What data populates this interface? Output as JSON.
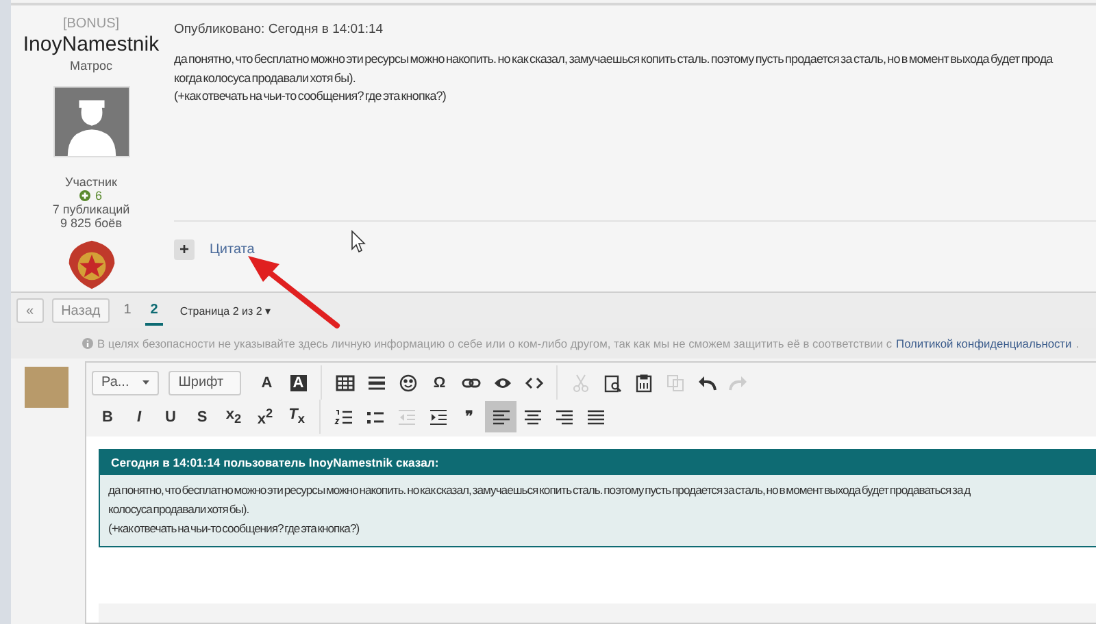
{
  "post": {
    "author": {
      "group": "[BONUS]",
      "name": "InoyNamestnik",
      "rank": "Матрос",
      "role": "Участник",
      "reputation": "6",
      "posts": "7 публикаций",
      "battles": "9 825 боёв"
    },
    "published": "Опубликовано: Сегодня в 14:01:14",
    "lines": [
      "да понятно, что бесплатно можно эти ресурсы можно накопить. но как сказал, замучаешься копить сталь. поэтому пусть продается за сталь, но в момент выхода будет прода",
      "когда колосуса продавали хотя бы).",
      "(+как отвечать на чьи-то сообщения? где эта кнопка?)"
    ],
    "add": "+",
    "quote": "Цитата"
  },
  "pagination": {
    "first": "«",
    "prev": "Назад",
    "pages": [
      {
        "label": "1",
        "selected": false
      },
      {
        "label": "2",
        "selected": true
      }
    ],
    "page_menu": "Страница 2 из 2",
    "page_menu_caret": "▾"
  },
  "notice": {
    "text": "В целях безопасности не указывайте здесь личную информацию о себе или о ком-либо другом, так как мы не сможем защитить её в соответствии с",
    "link": "Политикой конфиденциальности",
    "end": "."
  },
  "toolbar": [
    [
      {
        "kind": "dropdown",
        "label": "Ра..."
      },
      {
        "kind": "dropdown",
        "label": "Шрифт"
      },
      {
        "kind": "glyph",
        "label": "A",
        "disabled": false,
        "selected": false
      },
      {
        "kind": "inverse",
        "label": "A",
        "disabled": false,
        "selected": false
      },
      {
        "kind": "separator"
      },
      {
        "kind": "icon",
        "disabled": false,
        "selected": false
      },
      {
        "kind": "icon",
        "disabled": false,
        "selected": false
      },
      {
        "kind": "icon",
        "disabled": false,
        "selected": false
      },
      {
        "kind": "glyph",
        "label": "Ω",
        "disabled": false,
        "selected": false
      },
      {
        "kind": "icon",
        "disabled": false,
        "selected": false
      },
      {
        "kind": "icon",
        "disabled": false,
        "selected": false
      },
      {
        "kind": "icon",
        "disabled": false,
        "selected": false
      },
      {
        "kind": "separator"
      },
      {
        "kind": "icon",
        "disabled": true,
        "selected": false
      },
      {
        "kind": "icon",
        "disabled": false,
        "selected": false
      },
      {
        "kind": "icon",
        "disabled": false,
        "selected": false
      },
      {
        "kind": "icon",
        "disabled": true,
        "selected": false
      },
      {
        "kind": "icon",
        "disabled": false,
        "selected": false
      },
      {
        "kind": "icon",
        "disabled": true,
        "selected": false
      }
    ],
    [
      {
        "kind": "glyph",
        "label": "B",
        "disabled": false,
        "selected": false
      },
      {
        "kind": "glyph",
        "label": "*I*",
        "disabled": false,
        "selected": false
      },
      {
        "kind": "glyph",
        "label": "U",
        "disabled": false,
        "selected": false
      },
      {
        "kind": "glyph",
        "label": "S",
        "disabled": false,
        "selected": false
      },
      {
        "kind": "glyph",
        "label": "x$_{2}$",
        "disabled": false,
        "selected": false
      },
      {
        "kind": "glyph",
        "label": "x$^{2}$",
        "disabled": false,
        "selected": false
      },
      {
        "kind": "glyph",
        "label": "*T*$_{x}$",
        "disabled": false,
        "selected": false
      },
      {
        "kind": "separator"
      },
      {
        "kind": "icon",
        "disabled": false,
        "selected": false
      },
      {
        "kind": "icon",
        "disabled": false,
        "selected": false
      },
      {
        "kind": "icon",
        "disabled": true,
        "selected": false
      },
      {
        "kind": "icon",
        "disabled": false,
        "selected": false
      },
      {
        "kind": "glyph",
        "label": "❞",
        "disabled": false,
        "selected": false
      },
      {
        "kind": "icon",
        "disabled": false,
        "selected": true
      },
      {
        "kind": "icon",
        "disabled": false,
        "selected": false
      },
      {
        "kind": "icon",
        "disabled": false,
        "selected": false
      },
      {
        "kind": "icon",
        "disabled": false,
        "selected": false
      }
    ]
  ],
  "quote": {
    "header": "Сегодня в 14:01:14 пользователь InoyNamestnik сказал:",
    "lines": [
      "да понятно, что бесплатно можно эти ресурсы можно накопить. но как сказал, замучаешься копить сталь. поэтому пусть продается за сталь, но в момент выхода будет продаваться за д",
      "колосуса продавали хотя бы).",
      "(+как отвечать на чьи-то сообщения? где эта кнопка?)"
    ]
  }
}
